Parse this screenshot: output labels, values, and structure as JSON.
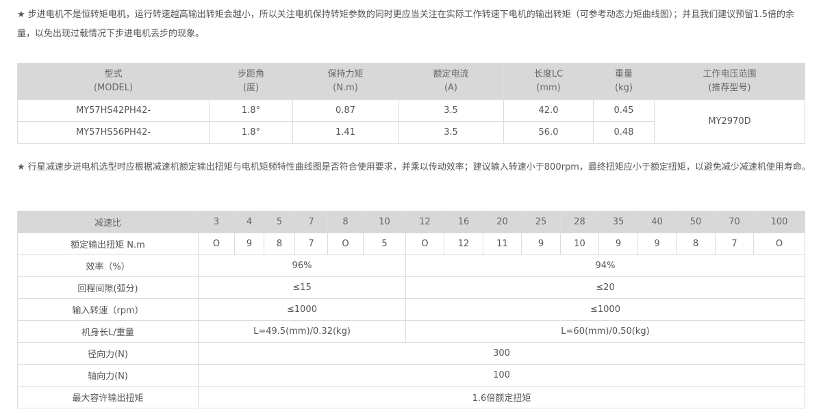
{
  "note1": "★ 步进电机不是恒转矩电机，运行转速越高输出转矩会越小，所以关注电机保持转矩参数的同时更应当关注在实际工作转速下电机的输出转矩（可参考动态力矩曲线图）；并且我们建议预留1.5倍的余量，以免出现过载情况下步进电机丢步的现象。",
  "motor_table": {
    "headers": [
      {
        "title": "型式",
        "sub": "(MODEL)"
      },
      {
        "title": "步距角",
        "sub": "(度)"
      },
      {
        "title": "保持力矩",
        "sub": "(N.m)"
      },
      {
        "title": "额定电流",
        "sub": "(A)"
      },
      {
        "title": "长度LC",
        "sub": "(mm)"
      },
      {
        "title": "重量",
        "sub": "(kg)"
      },
      {
        "title": "工作电压范围",
        "sub": "(推荐型号)"
      }
    ],
    "rows": [
      [
        "MY57HS42PH42-",
        "1.8°",
        "0.87",
        "3.5",
        "42.0",
        "0.45"
      ],
      [
        "MY57HS56PH42-",
        "1.8°",
        "1.41",
        "3.5",
        "56.0",
        "0.48"
      ]
    ],
    "driver": "MY2970D"
  },
  "note2": "★ 行星减速步进电机选型时应根据减速机额定输出扭矩与电机矩频特性曲线图是否符合使用要求，并乘以传动效率；建议输入转速小于800rpm，最终扭矩应小于额定扭矩，以避免减少减速机使用寿命。",
  "gear_table": {
    "ratio_label": "减速比",
    "ratios": [
      "3",
      "4",
      "5",
      "7",
      "8",
      "10",
      "12",
      "16",
      "20",
      "25",
      "28",
      "35",
      "40",
      "50",
      "70",
      "100"
    ],
    "torque_label": "额定输出扭矩 N.m",
    "torques": [
      "O",
      "9",
      "8",
      "7",
      "O",
      "5",
      "O",
      "12",
      "11",
      "9",
      "10",
      "9",
      "9",
      "8",
      "7",
      "O"
    ],
    "efficiency": {
      "label": "效率（%）",
      "low": "96%",
      "high": "94%"
    },
    "backlash": {
      "label": "回程间隙(弧分)",
      "low": "≤15",
      "high": "≤20"
    },
    "input_speed": {
      "label": "输入转速（rpm）",
      "low": "≤1000",
      "high": "≤1000"
    },
    "length_weight": {
      "label": "机身长L/重量",
      "low": "L=49.5(mm)/0.32(kg)",
      "high": "L=60(mm)/0.50(kg)"
    },
    "radial_force": {
      "label": "径向力(N)",
      "value": "300"
    },
    "axial_force": {
      "label": "轴向力(N)",
      "value": "100"
    },
    "max_torque": {
      "label": "最大容许输出扭矩",
      "value": "1.6倍额定扭矩"
    }
  }
}
